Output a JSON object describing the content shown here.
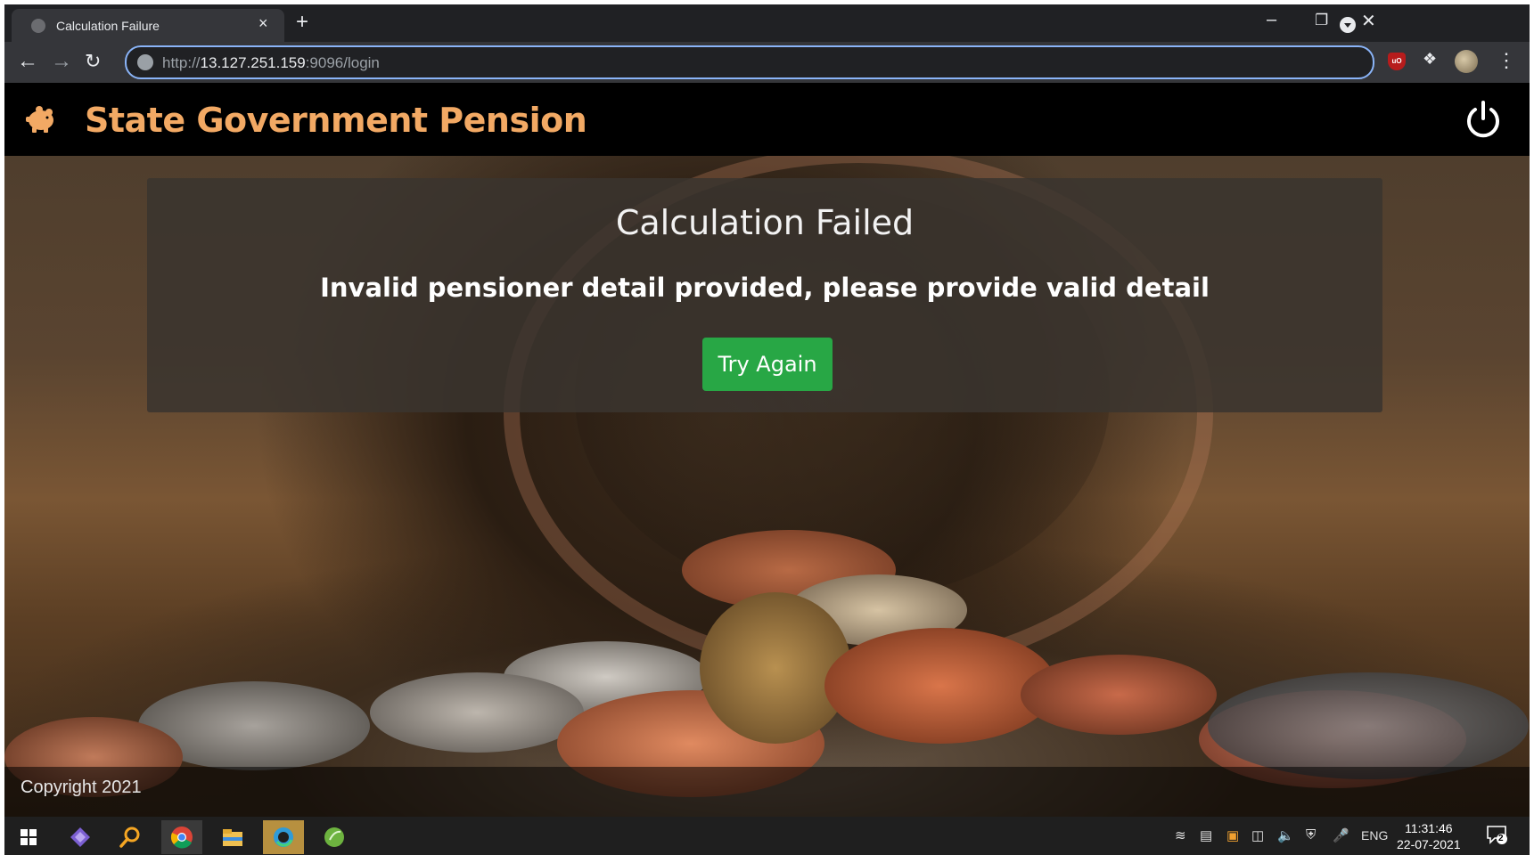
{
  "browser": {
    "tab_title": "Calculation Failure",
    "tab_close_glyph": "×",
    "new_tab_glyph": "+",
    "url_scheme": "http://",
    "url_host": "13.127.251.159",
    "url_path": ":9096/login",
    "icons": [
      "back-icon",
      "forward-icon",
      "reload-icon",
      "site-info-icon",
      "ublock-extension-icon",
      "extensions-puzzle-icon",
      "profile-avatar",
      "menu-kebab-icon"
    ],
    "ublock_label": "uO"
  },
  "app": {
    "brand_title": "State Government Pension",
    "brand_color": "#f2a964",
    "power_icon": "power-icon"
  },
  "error": {
    "title": "Calculation Failed",
    "message": "Invalid pensioner detail provided, please provide valid detail",
    "button_label": "Try Again",
    "button_color": "#28a745"
  },
  "footer": {
    "copyright": "Copyright 2021"
  },
  "taskbar": {
    "apps": [
      "windows-start-icon",
      "visual-studio-icon",
      "search-icon",
      "chrome-icon",
      "file-explorer-icon",
      "edge-icon",
      "spring-tool-suite-icon"
    ],
    "language": "ENG",
    "time": "11:31:46",
    "date": "22-07-2021",
    "notification_count": "2"
  }
}
